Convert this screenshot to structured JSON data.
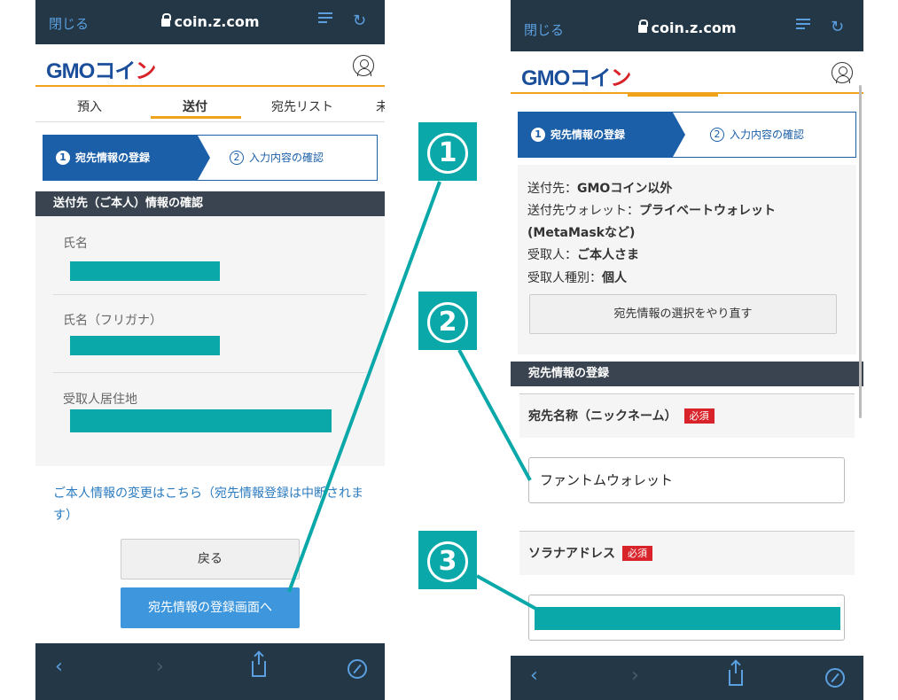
{
  "browser": {
    "close_label": "閉じる",
    "url": "coin.z.com"
  },
  "colors": {
    "topbar": "#243746",
    "brand_blue": "#1b5fa8",
    "accent_orange": "#f0a21a",
    "button_blue": "#3e97dd",
    "callout_teal": "#0aa8a8",
    "required_red": "#d8232a"
  },
  "left": {
    "logo": {
      "gmo": "GMO",
      "coin": "コイ",
      "in": "ン"
    },
    "tabs": [
      "預入",
      "送付",
      "宛先リスト",
      "未"
    ],
    "active_tab": "送付",
    "stepper": {
      "step1_num": "1",
      "step1_label": "宛先情報の登録",
      "step2_num": "2",
      "step2_label": "入力内容の確認"
    },
    "section_title": "送付先（ご本人）情報の確認",
    "fields": [
      {
        "label": "氏名"
      },
      {
        "label": "氏名（フリガナ）"
      },
      {
        "label": "受取人居住地"
      }
    ],
    "change_link": "ご本人情報の変更はこちら（宛先情報登録は中断されます）",
    "back_button": "戻る",
    "next_button": "宛先情報の登録画面へ"
  },
  "right": {
    "logo": {
      "gmo": "GMO",
      "coin": "コイ",
      "in": "ン"
    },
    "stepper": {
      "step1_num": "1",
      "step1_label": "宛先情報の登録",
      "step2_num": "2",
      "step2_label": "入力内容の確認"
    },
    "details": {
      "dest_label": "送付先：",
      "dest_value": "GMOコイン以外",
      "wallet_label": "送付先ウォレット：",
      "wallet_value": "プライベートウォレット",
      "wallet_value2": "(MetaMaskなど)",
      "recipient_label": "受取人：",
      "recipient_value": "ご本人さま",
      "type_label": "受取人種別：",
      "type_value": "個人"
    },
    "reselect_button": "宛先情報の選択をやり直す",
    "section_title": "宛先情報の登録",
    "nickname_label": "宛先名称（ニックネーム）",
    "required_badge": "必須",
    "nickname_value": "ファントムウォレット",
    "address_label": "ソラナアドレス"
  },
  "callouts": [
    "1",
    "2",
    "3"
  ],
  "icons": {
    "reader": "reader-icon",
    "reload": "reload-icon",
    "back": "back-arrow-icon",
    "forward": "forward-arrow-icon",
    "share": "share-icon",
    "compass": "compass-icon"
  }
}
